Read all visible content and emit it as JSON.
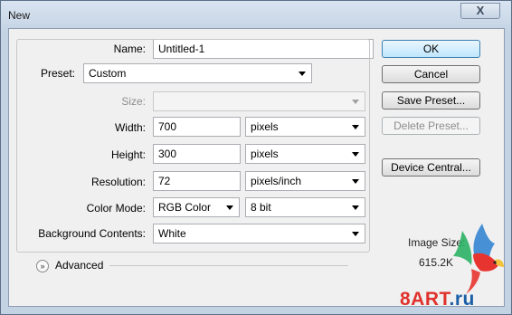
{
  "window": {
    "title": "New",
    "close_glyph": "X"
  },
  "form": {
    "name": {
      "label": "Name:",
      "value": "Untitled-1"
    },
    "preset": {
      "label": "Preset:",
      "value": "Custom"
    },
    "size": {
      "label": "Size:",
      "value": ""
    },
    "width": {
      "label": "Width:",
      "value": "700",
      "unit": "pixels"
    },
    "height": {
      "label": "Height:",
      "value": "300",
      "unit": "pixels"
    },
    "resolution": {
      "label": "Resolution:",
      "value": "72",
      "unit": "pixels/inch"
    },
    "color_mode": {
      "label": "Color Mode:",
      "value": "RGB Color",
      "depth": "8 bit"
    },
    "background": {
      "label": "Background Contents:",
      "value": "White"
    },
    "advanced": {
      "label": "Advanced",
      "toggle_glyph": "»"
    }
  },
  "buttons": {
    "ok": "OK",
    "cancel": "Cancel",
    "save_preset": "Save Preset...",
    "delete_preset": "Delete Preset...",
    "device_central": "Device Central..."
  },
  "image_size": {
    "label": "Image Size:",
    "value": "615.2K"
  },
  "watermark": {
    "brand": "8ART",
    "domain": ".ru"
  },
  "colors": {
    "accent": "#3c7fb1",
    "watermark_red": "#e0312c",
    "watermark_blue": "#1b5fa7"
  }
}
